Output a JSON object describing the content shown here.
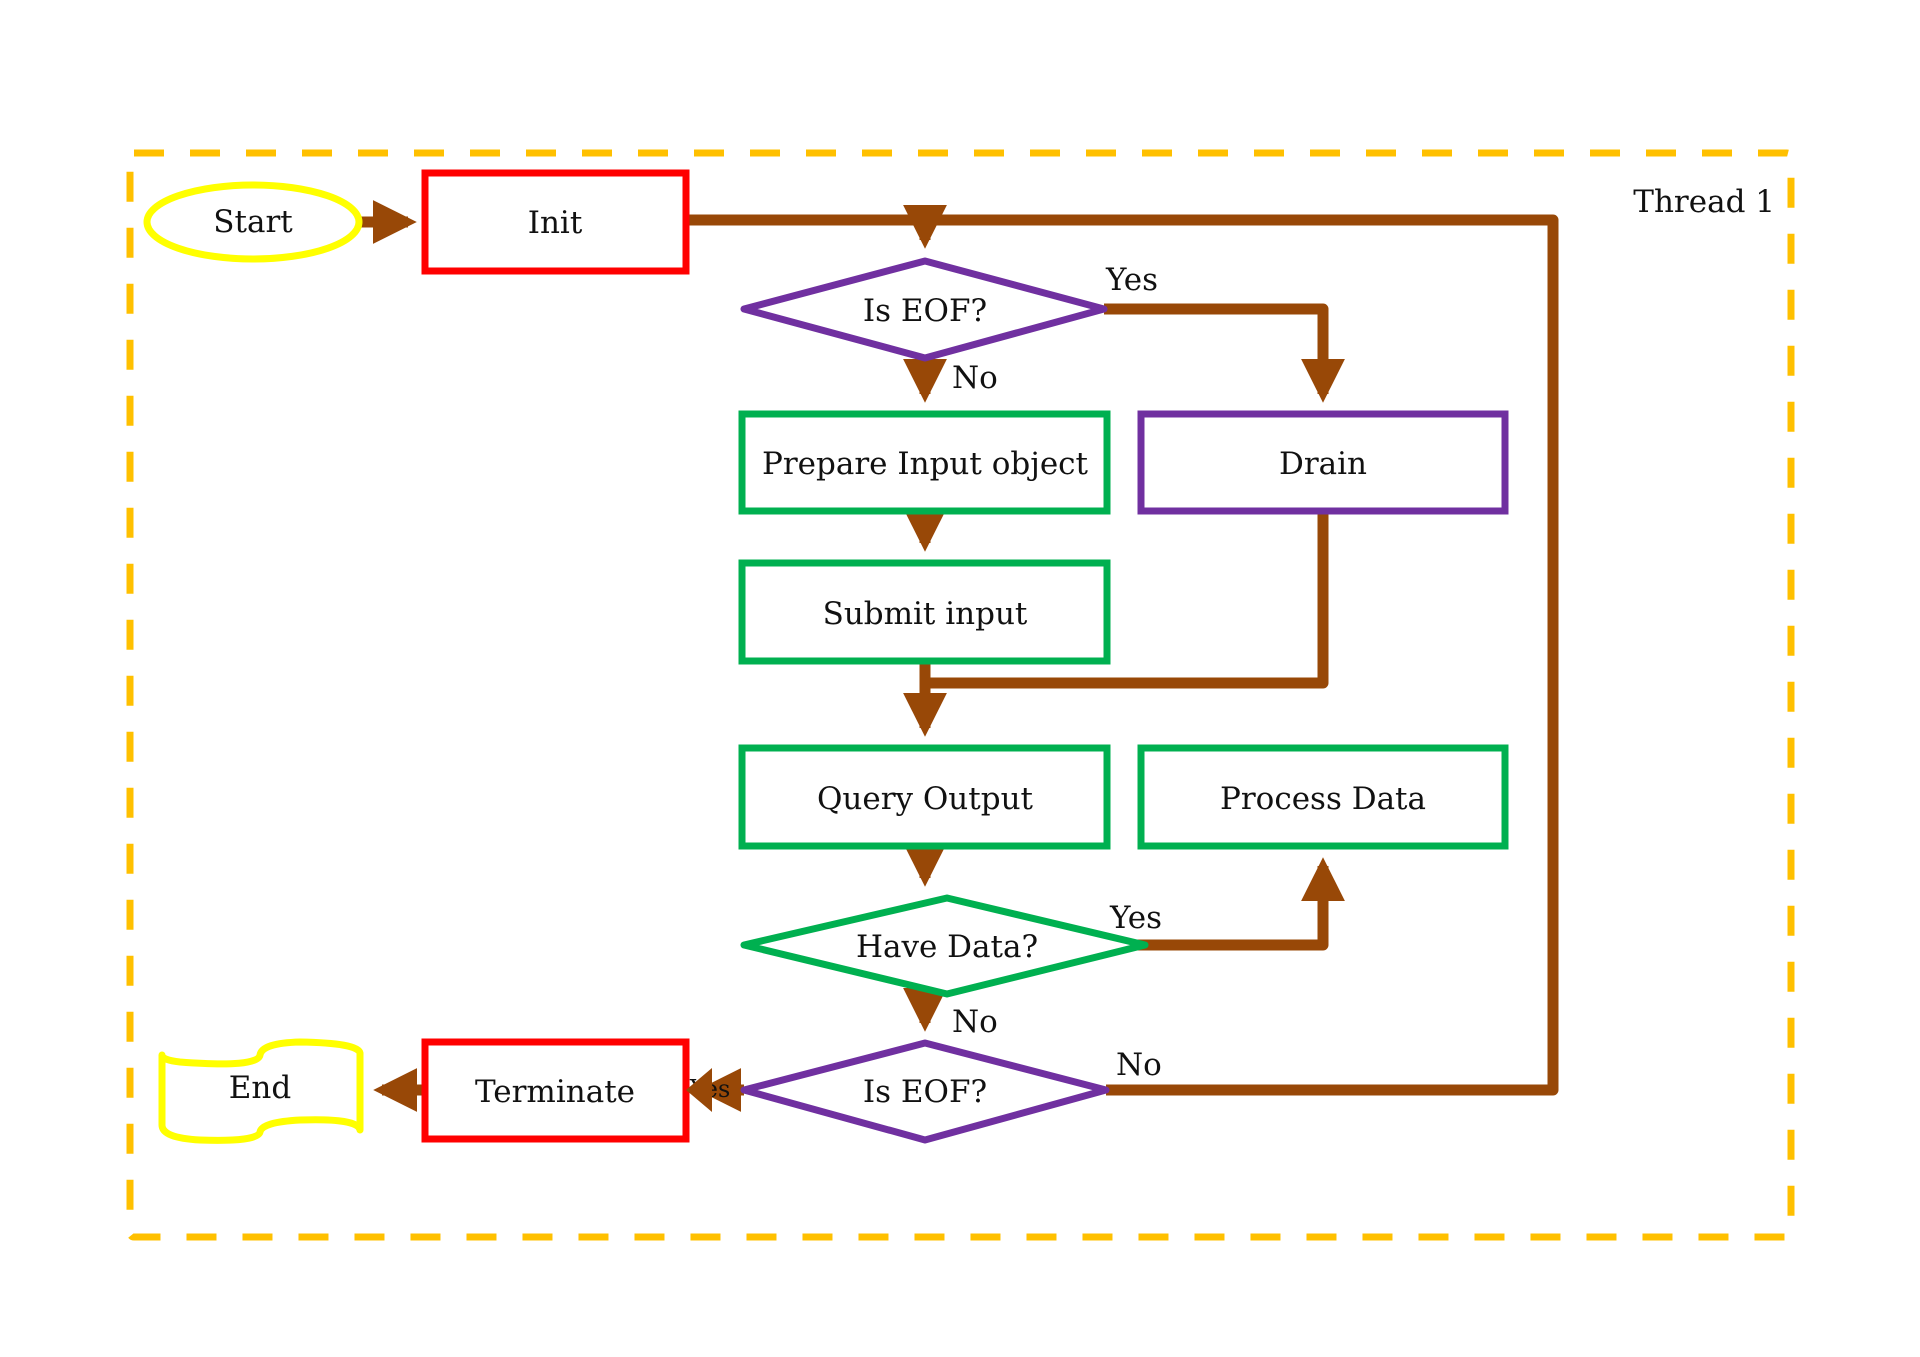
{
  "diagram": {
    "type": "flowchart",
    "container": {
      "label": "Thread 1",
      "border_color": "#FFC000",
      "style": "dashed"
    },
    "colors": {
      "arrow": "#984807",
      "terminal": "#FFFF00",
      "init_terminate": "#FF0000",
      "decision_eof": "#7030A0",
      "process": "#00B050"
    },
    "nodes": [
      {
        "id": "start",
        "shape": "ellipse",
        "label": "Start"
      },
      {
        "id": "init",
        "shape": "rect",
        "label": "Init"
      },
      {
        "id": "is_eof_1",
        "shape": "diamond",
        "label": "Is EOF?"
      },
      {
        "id": "prepare",
        "shape": "rect",
        "label": "Prepare Input object"
      },
      {
        "id": "drain",
        "shape": "rect",
        "label": "Drain"
      },
      {
        "id": "submit",
        "shape": "rect",
        "label": "Submit input"
      },
      {
        "id": "query",
        "shape": "rect",
        "label": "Query Output"
      },
      {
        "id": "process",
        "shape": "rect",
        "label": "Process Data"
      },
      {
        "id": "have_data",
        "shape": "diamond",
        "label": "Have Data?"
      },
      {
        "id": "is_eof_2",
        "shape": "diamond",
        "label": "Is EOF?"
      },
      {
        "id": "terminate",
        "shape": "rect",
        "label": "Terminate"
      },
      {
        "id": "end",
        "shape": "document",
        "label": "End"
      }
    ],
    "edges": [
      {
        "from": "start",
        "to": "init",
        "label": ""
      },
      {
        "from": "init",
        "to": "is_eof_1",
        "label": ""
      },
      {
        "from": "is_eof_1",
        "to": "drain",
        "label": "Yes"
      },
      {
        "from": "is_eof_1",
        "to": "prepare",
        "label": "No"
      },
      {
        "from": "prepare",
        "to": "submit",
        "label": ""
      },
      {
        "from": "submit",
        "to": "query",
        "label": ""
      },
      {
        "from": "drain",
        "to": "query",
        "label": ""
      },
      {
        "from": "query",
        "to": "have_data",
        "label": ""
      },
      {
        "from": "have_data",
        "to": "process",
        "label": "Yes"
      },
      {
        "from": "have_data",
        "to": "is_eof_2",
        "label": "No"
      },
      {
        "from": "is_eof_2",
        "to": "terminate",
        "label": "Yes"
      },
      {
        "from": "is_eof_2",
        "to": "is_eof_1",
        "label": "No"
      },
      {
        "from": "terminate",
        "to": "end",
        "label": ""
      }
    ]
  }
}
